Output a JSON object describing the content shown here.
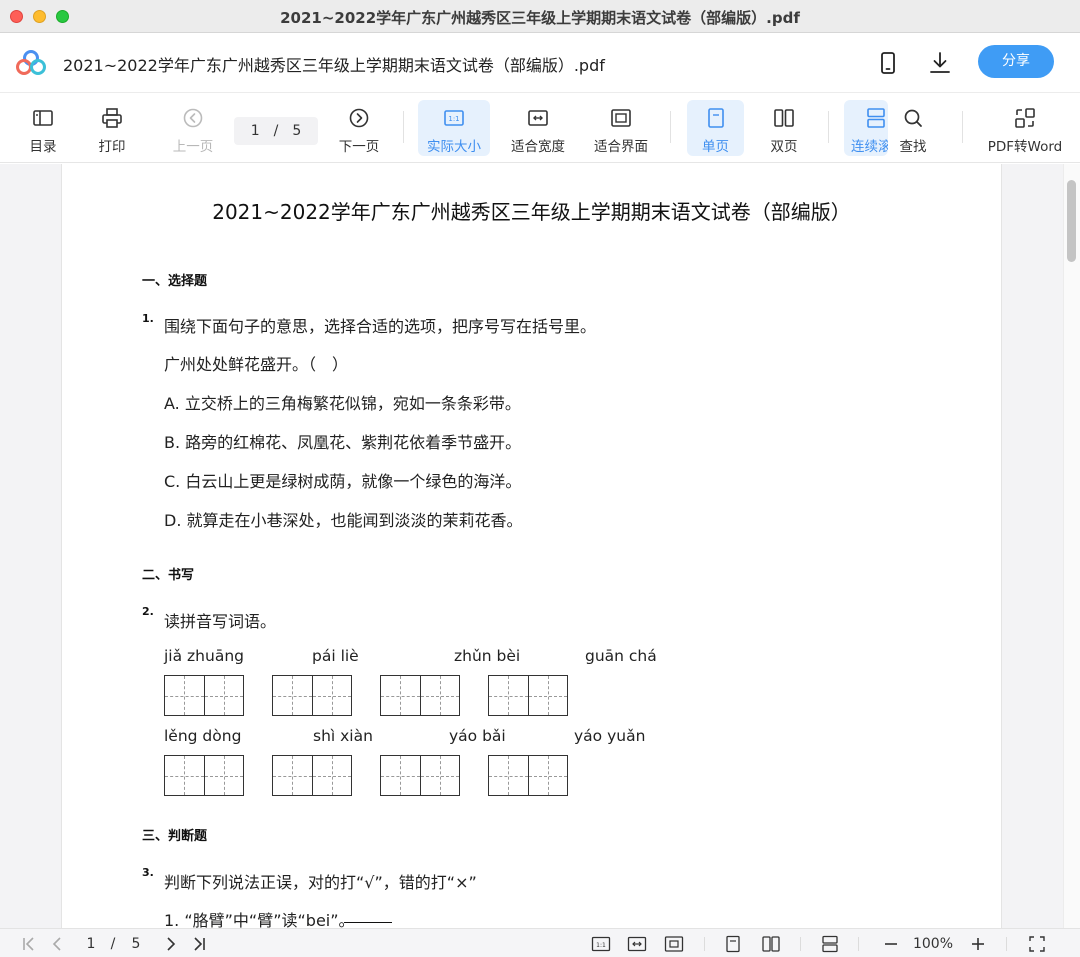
{
  "window": {
    "title": "2021~2022学年广东广州越秀区三年级上学期期末语文试卷（部编版）.pdf"
  },
  "header": {
    "doc_title": "2021~2022学年广东广州越秀区三年级上学期期末语文试卷（部编版）.pdf",
    "share_label": "分享"
  },
  "toolbar": {
    "items": [
      {
        "label": "目录",
        "icon": "toc-icon"
      },
      {
        "label": "打印",
        "icon": "print-icon"
      },
      {
        "label": "上一页",
        "icon": "prev-page-icon"
      },
      {
        "label": "下一页",
        "icon": "next-page-icon"
      },
      {
        "label": "实际大小",
        "icon": "actual-size-icon"
      },
      {
        "label": "适合宽度",
        "icon": "fit-width-icon"
      },
      {
        "label": "适合界面",
        "icon": "fit-page-icon"
      },
      {
        "label": "单页",
        "icon": "single-page-icon"
      },
      {
        "label": "双页",
        "icon": "double-page-icon"
      },
      {
        "label": "连续滚",
        "icon": "continuous-scroll-icon"
      },
      {
        "label": "查找",
        "icon": "search-icon"
      },
      {
        "label": "PDF转Word",
        "icon": "convert-word-icon"
      }
    ],
    "current_page": "1",
    "page_sep": "/",
    "total_pages": "5"
  },
  "document": {
    "title": "2021~2022学年广东广州越秀区三年级上学期期末语文试卷（部编版）",
    "sections": [
      "一、选择题",
      "二、书写",
      "三、判断题"
    ],
    "q1": {
      "num": "1.",
      "prompt": "围绕下面句子的意思，选择合适的选项，把序号写在括号里。",
      "sentence": "广州处处鲜花盛开。（　）",
      "options": [
        "A. 立交桥上的三角梅繁花似锦，宛如一条条彩带。",
        "B. 路旁的红棉花、凤凰花、紫荆花依着季节盛开。",
        "C. 白云山上更是绿树成荫，就像一个绿色的海洋。",
        "D. 就算走在小巷深处，也能闻到淡淡的茉莉花香。"
      ]
    },
    "q2": {
      "num": "2.",
      "prompt": "读拼音写词语。",
      "pinyin": [
        "jiǎ zhuāng",
        "pái liè",
        "zhǔn bèi",
        "guān chá",
        "lěng dòng",
        "shì xiàn",
        "yáo bǎi",
        "yáo yuǎn"
      ]
    },
    "q3": {
      "num": "3.",
      "prompt": "判断下列说法正误，对的打“√”，错的打“×”",
      "item1": "1. “胳臂”中“臂”读“bei”。"
    }
  },
  "statusbar": {
    "current_page": "1",
    "page_sep": "/",
    "total_pages": "5",
    "zoom": "100%"
  },
  "colors": {
    "accent": "#3f9cf5",
    "active_bg": "#e6f1fd",
    "titlebar": "#ececec"
  }
}
